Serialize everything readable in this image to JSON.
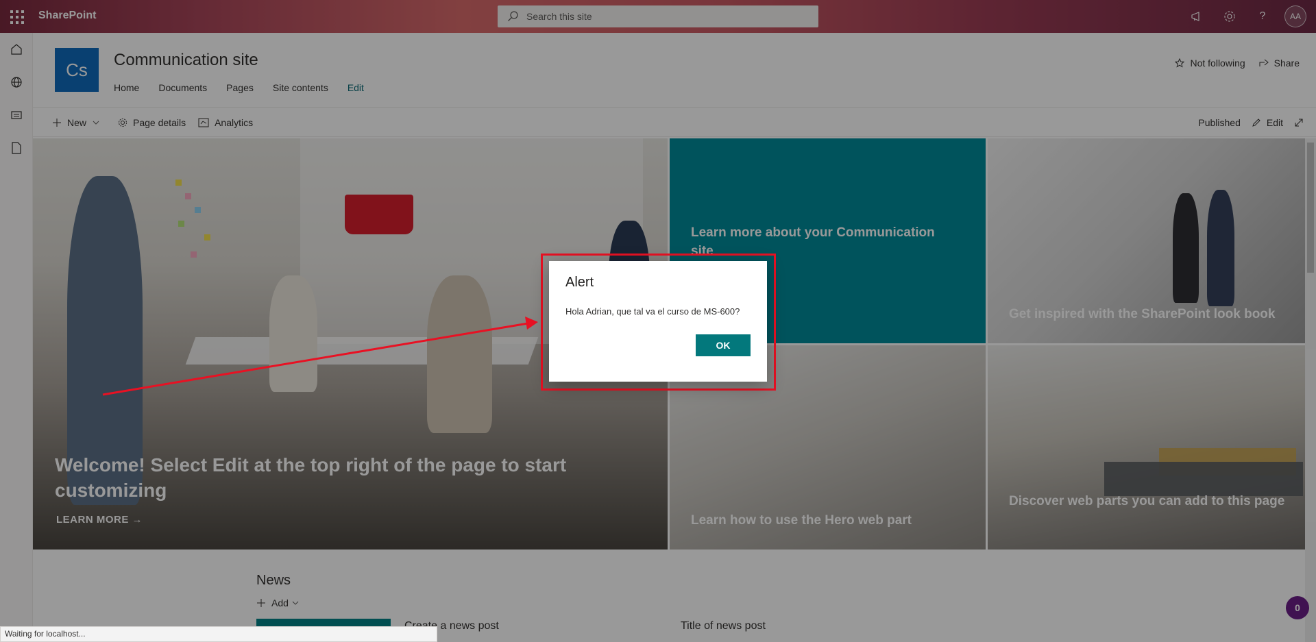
{
  "suitebar": {
    "brand": "SharePoint",
    "search_placeholder": "Search this site",
    "avatar_initials": "AA"
  },
  "header": {
    "logo_text": "Cs",
    "site_title": "Communication site",
    "nav": [
      "Home",
      "Documents",
      "Pages",
      "Site contents",
      "Edit"
    ],
    "follow_label": "Not following",
    "share_label": "Share"
  },
  "commandbar": {
    "new_label": "New",
    "page_details_label": "Page details",
    "analytics_label": "Analytics",
    "status_label": "Published",
    "edit_label": "Edit"
  },
  "hero": {
    "main_caption": "Welcome! Select Edit at the top right of the page to start customizing",
    "learn_more": "LEARN MORE",
    "tile_teal": "Learn more about your Communication site",
    "tile_top_right": "Get inspired with the SharePoint look book",
    "tile_bottom_middle": "Learn how to use the Hero web part",
    "tile_bottom_right": "Discover web parts you can add to this page"
  },
  "news": {
    "title": "News",
    "add_label": "Add",
    "create_label": "Create a news post",
    "post_title": "Title of news post"
  },
  "alert": {
    "title": "Alert",
    "message": "Hola Adrian, que tal va el curso de MS-600?",
    "ok_label": "OK"
  },
  "statusbar": {
    "text": "Waiting for localhost..."
  },
  "help_badge": {
    "count": "0"
  },
  "colors": {
    "accent_teal": "#03787c",
    "highlight_red": "#e81123",
    "logo_blue": "#0f6cbd"
  }
}
